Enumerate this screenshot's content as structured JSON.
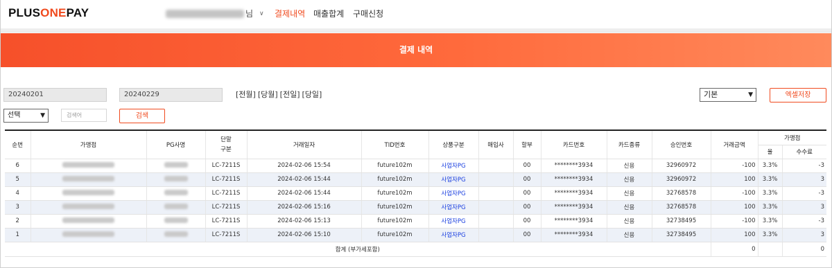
{
  "header": {
    "logo_prefix": "PLUS",
    "logo_accent": "ONE",
    "logo_suffix": "PAY",
    "user_suffix": "님",
    "nav": [
      "결제내역",
      "매출합계",
      "구매신청"
    ],
    "active_nav": "결제내역"
  },
  "banner": {
    "title": "결제 내역"
  },
  "filters": {
    "start_date": "20240201",
    "end_date": "20240229",
    "quick_ranges": [
      "[전월]",
      "[당월]",
      "[전일]",
      "[당일]"
    ],
    "search_type": "선택",
    "search_placeholder": "검색어",
    "search_button": "검색",
    "view_select": "기본",
    "excel_button": "엑셀저장"
  },
  "table": {
    "headers": {
      "seq": "순번",
      "merchant": "가맹점",
      "pg": "PG사명",
      "terminal": "단말\n구분",
      "datetime": "거래일자",
      "tid": "TID번호",
      "product": "상품구분",
      "acquirer": "매입사",
      "installment": "할부",
      "card_no": "카드번호",
      "card_type": "카드종류",
      "approval": "승인번호",
      "amount": "거래금액",
      "merchant_group": "가맹점",
      "rate": "율",
      "fee": "수수료"
    },
    "rows": [
      {
        "seq": "6",
        "terminal": "LC-7211S",
        "datetime": "2024-02-06 15:54",
        "tid": "future102m",
        "product": "사업자PG",
        "installment": "00",
        "card_no": "********3934",
        "card_type": "신용",
        "approval": "32960972",
        "amount": "-100",
        "rate": "3.3%",
        "fee": "-3"
      },
      {
        "seq": "5",
        "terminal": "LC-7211S",
        "datetime": "2024-02-06 15:44",
        "tid": "future102m",
        "product": "사업자PG",
        "installment": "00",
        "card_no": "********3934",
        "card_type": "신용",
        "approval": "32960972",
        "amount": "100",
        "rate": "3.3%",
        "fee": "3"
      },
      {
        "seq": "4",
        "terminal": "LC-7211S",
        "datetime": "2024-02-06 15:44",
        "tid": "future102m",
        "product": "사업자PG",
        "installment": "00",
        "card_no": "********3934",
        "card_type": "신용",
        "approval": "32768578",
        "amount": "-100",
        "rate": "3.3%",
        "fee": "-3"
      },
      {
        "seq": "3",
        "terminal": "LC-7211S",
        "datetime": "2024-02-06 15:16",
        "tid": "future102m",
        "product": "사업자PG",
        "installment": "00",
        "card_no": "********3934",
        "card_type": "신용",
        "approval": "32768578",
        "amount": "100",
        "rate": "3.3%",
        "fee": "3"
      },
      {
        "seq": "2",
        "terminal": "LC-7211S",
        "datetime": "2024-02-06 15:13",
        "tid": "future102m",
        "product": "사업자PG",
        "installment": "00",
        "card_no": "********3934",
        "card_type": "신용",
        "approval": "32738495",
        "amount": "-100",
        "rate": "3.3%",
        "fee": "-3"
      },
      {
        "seq": "1",
        "terminal": "LC-7211S",
        "datetime": "2024-02-06 15:10",
        "tid": "future102m",
        "product": "사업자PG",
        "installment": "00",
        "card_no": "********3934",
        "card_type": "신용",
        "approval": "32738495",
        "amount": "100",
        "rate": "3.3%",
        "fee": "3"
      }
    ],
    "summary": {
      "label": "합계 (부가세포함)",
      "amount": "0",
      "fee": "0"
    }
  },
  "colors": {
    "accent": "#f04a1e",
    "link": "#1a3fe0",
    "row_alt": "#edf1f8"
  }
}
